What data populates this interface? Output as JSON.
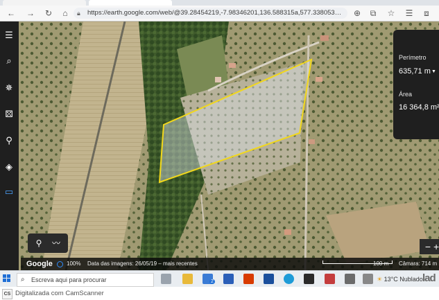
{
  "browser": {
    "url": "https://earth.google.com/web/@39.28454219,-7.98346201,136.588315a,577.33805386d,35y,0...",
    "icons": [
      "back-icon",
      "forward-icon",
      "reload-icon",
      "home-icon",
      "lock-icon",
      "zoom-icon",
      "star-icon",
      "extensions-icon",
      "favorites-icon",
      "collections-icon"
    ]
  },
  "left_rail": [
    "menu-icon",
    "search-icon",
    "voyager-icon",
    "feeling-lucky-icon",
    "projects-icon",
    "layers-icon",
    "measure-icon"
  ],
  "measure_panel": {
    "perimeter_label": "Perímetro",
    "perimeter_value": "635,71 m",
    "area_label": "Área",
    "area_value": "16 364,8 m²"
  },
  "status_bar": {
    "brand": "Google",
    "zoom": "100%",
    "imagery_date": "Data das imagens: 26/05/19 – mais recentes",
    "scale": "100 m",
    "altitude": "Câmara: 714 m"
  },
  "taskbar": {
    "search_placeholder": "Escreva aqui para procurar",
    "badge_count": "2",
    "weather": "13°C  Nublado"
  },
  "watermark": {
    "logo_text": "lad",
    "camscanner": "Digitalizada com CamScanner",
    "cs_badge": "CS"
  },
  "colors": {
    "polygon_outline": "#f2d81b",
    "rail_bg": "#1f1f1f",
    "accent_blue": "#2f8cff"
  }
}
